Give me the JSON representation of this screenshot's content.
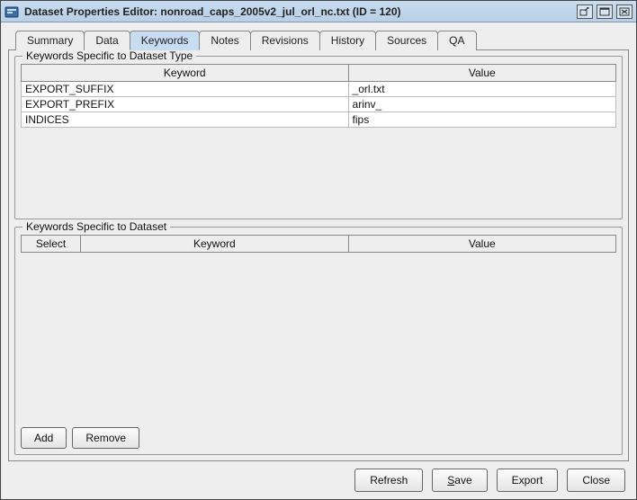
{
  "title": "Dataset Properties Editor: nonroad_caps_2005v2_jul_orl_nc.txt (ID = 120)",
  "tabs": {
    "summary": "Summary",
    "data": "Data",
    "keywords": "Keywords",
    "notes": "Notes",
    "revisions": "Revisions",
    "history": "History",
    "sources": "Sources",
    "qa": "QA"
  },
  "group1": {
    "title": "Keywords Specific to Dataset Type",
    "headers": {
      "keyword": "Keyword",
      "value": "Value"
    },
    "rows": [
      {
        "keyword": "EXPORT_SUFFIX",
        "value": "_orl.txt"
      },
      {
        "keyword": "EXPORT_PREFIX",
        "value": "arinv_"
      },
      {
        "keyword": "INDICES",
        "value": "fips"
      }
    ]
  },
  "group2": {
    "title": "Keywords Specific to Dataset",
    "headers": {
      "select": "Select",
      "keyword": "Keyword",
      "value": "Value"
    }
  },
  "buttons": {
    "add": "Add",
    "remove": "Remove",
    "refresh": "Refresh",
    "save_pre": "S",
    "save_post": "ave",
    "export": "Export",
    "close": "Close"
  }
}
